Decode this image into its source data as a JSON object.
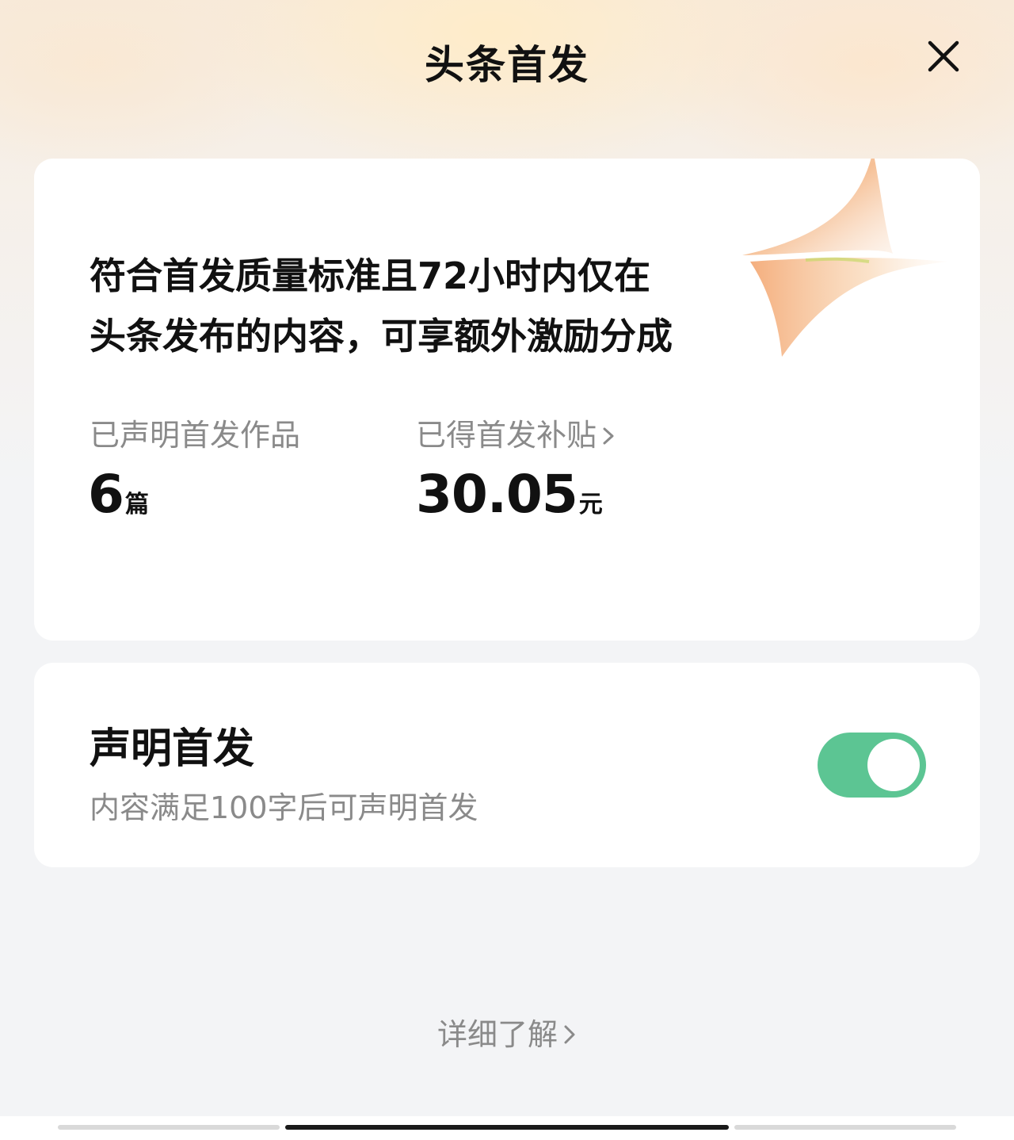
{
  "header": {
    "title": "头条首发",
    "close_icon": "close-icon"
  },
  "info_card": {
    "headline_line1": "符合首发质量标准且72小时内仅在",
    "headline_line2": "头条发布的内容，可享额外激励分成",
    "declared_works": {
      "label": "已声明首发作品",
      "value": "6",
      "unit": "篇"
    },
    "subsidy": {
      "label": "已得首发补贴",
      "value": "30.05",
      "unit": "元",
      "chevron_icon": "chevron-right-icon"
    }
  },
  "declare_card": {
    "title": "声明首发",
    "subtitle": "内容满足100字后可声明首发",
    "toggle": {
      "state": "on",
      "color": "#5cc593"
    }
  },
  "footer": {
    "more_label": "详细了解",
    "chevron_icon": "chevron-right-icon"
  },
  "colors": {
    "accent": "#5cc593",
    "text_primary": "#111111",
    "text_secondary": "#8a8a8a",
    "background": "#f3f4f6"
  }
}
